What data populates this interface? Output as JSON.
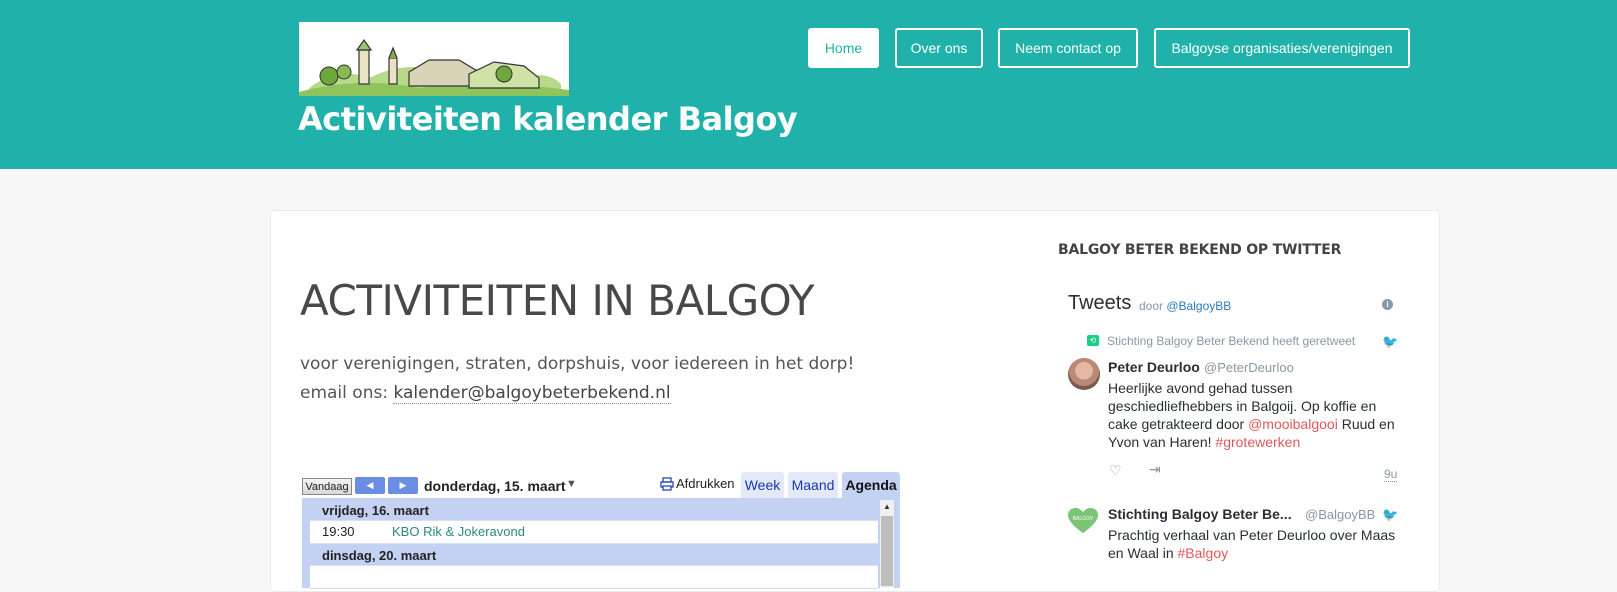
{
  "header": {
    "site_title": "Activiteiten kalender Balgoy",
    "nav": [
      {
        "label": "Home",
        "active": true
      },
      {
        "label": "Over ons"
      },
      {
        "label": "Neem contact op"
      },
      {
        "label": "Balgoyse organisaties/verenigingen"
      }
    ],
    "colors": {
      "accent": "#20b2aa"
    }
  },
  "main": {
    "title": "ACTIVITEITEN IN BALGOY",
    "intro_line1": "voor verenigingen, straten, dorpshuis, voor iedereen in het dorp!",
    "intro_line2_prefix": "email ons: ",
    "email": "kalender@balgoybeterbekend.nl"
  },
  "calendar": {
    "today_label": "Vandaag",
    "current_date": "donderdag, 15. maart",
    "print_label": "Afdrukken",
    "tabs": [
      {
        "label": "Week"
      },
      {
        "label": "Maand"
      },
      {
        "label": "Agenda",
        "active": true
      }
    ],
    "days": [
      {
        "date": "vrijdag, 16. maart",
        "events": [
          {
            "time": "19:30",
            "title": "KBO Rik & Jokeravond"
          }
        ]
      },
      {
        "date": "dinsdag, 20. maart",
        "events": []
      }
    ]
  },
  "sidebar": {
    "heading": "BALGOY BETER BEKEND OP TWITTER",
    "twitter": {
      "title": "Tweets",
      "by_prefix": "door",
      "by_handle": "@BalgoyBB",
      "retweet_note": "Stichting Balgoy Beter Bekend heeft geretweet",
      "tweets": [
        {
          "name": "Peter Deurloo",
          "handle": "@PeterDeurloo",
          "text_part1": "Heerlijke avond gehad tussen geschiedliefhebbers in Balgoij. Op koffie en cake getrakteerd door ",
          "mention": "@mooibalgooi",
          "text_part2": " Ruud en Yvon van Haren! ",
          "hashtag": "#grotewerken",
          "time": "9u"
        },
        {
          "name": "Stichting Balgoy Beter Be...",
          "handle": "@BalgoyBB",
          "text_part1": "Prachtig verhaal van Peter Deurloo over Maas en Waal in ",
          "hashtag": "#Balgoy"
        }
      ]
    }
  }
}
